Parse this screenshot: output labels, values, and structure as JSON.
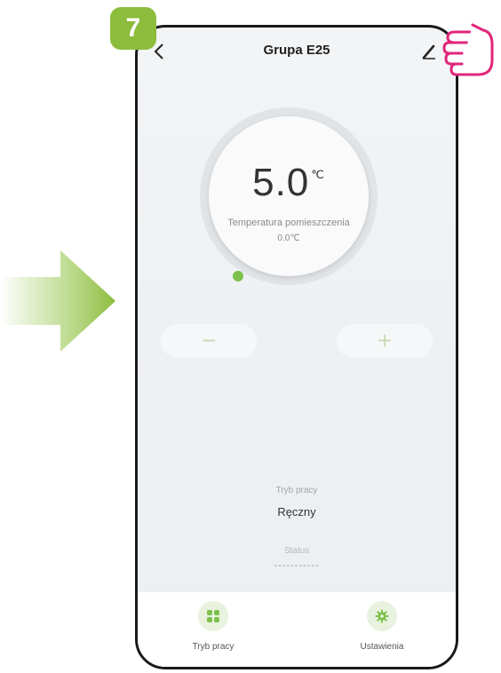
{
  "step": {
    "number": "7"
  },
  "header": {
    "title": "Grupa E25",
    "back_icon": "chevron-left-icon",
    "edit_icon": "pencil-icon"
  },
  "dial": {
    "setpoint": "5.0",
    "unit": "℃",
    "room_label": "Temperatura pomieszczenia",
    "room_value": "0.0℃",
    "accent_color": "#7cc14a"
  },
  "controls": {
    "minus": "−",
    "plus": "+"
  },
  "info": {
    "mode_label": "Tryb pracy",
    "mode_value": "Ręczny",
    "status_label": "Status",
    "status_value": "-----------"
  },
  "bottom_nav": [
    {
      "label": "Tryb pracy",
      "icon": "grid-icon"
    },
    {
      "label": "Ustawienia",
      "icon": "gear-icon"
    }
  ],
  "colors": {
    "badge": "#8cbc3c",
    "arrow": "#a7cf6a",
    "hand": "#e0277a"
  }
}
